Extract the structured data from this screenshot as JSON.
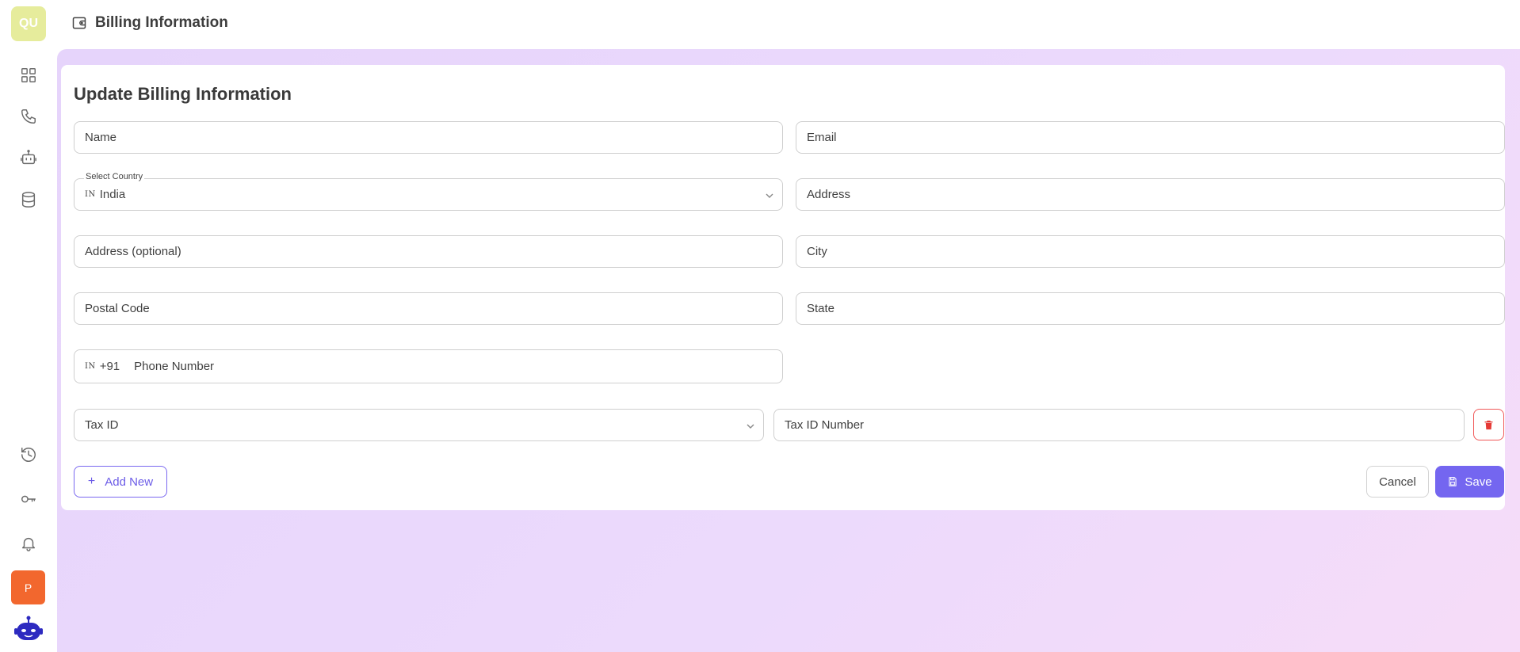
{
  "sidebar": {
    "avatar_initials": "QU",
    "nav_icons": [
      "dashboard-icon",
      "phone-icon",
      "robot-icon",
      "database-icon",
      "history-icon",
      "key-icon",
      "bell-icon"
    ],
    "user_badge": "P",
    "colors": {
      "avatar_bg": "#e6ec9c",
      "badge_bg": "#f2672e"
    }
  },
  "header": {
    "title": "Billing Information",
    "icon": "wallet-icon"
  },
  "form": {
    "title": "Update Billing Information",
    "name_placeholder": "Name",
    "email_placeholder": "Email",
    "country": {
      "label": "Select Country",
      "flag_code": "IN",
      "selected": "India"
    },
    "address_placeholder": "Address",
    "address_optional_placeholder": "Address (optional)",
    "city_placeholder": "City",
    "postal_code_placeholder": "Postal Code",
    "state_placeholder": "State",
    "phone": {
      "flag_code": "IN",
      "dial_code": "+91",
      "placeholder": "Phone Number"
    },
    "tax_id_placeholder": "Tax ID",
    "tax_id_number_placeholder": "Tax ID Number"
  },
  "actions": {
    "add_new": "Add New",
    "cancel": "Cancel",
    "save": "Save"
  },
  "colors": {
    "accent": "#7466f0",
    "danger": "#e53935"
  }
}
